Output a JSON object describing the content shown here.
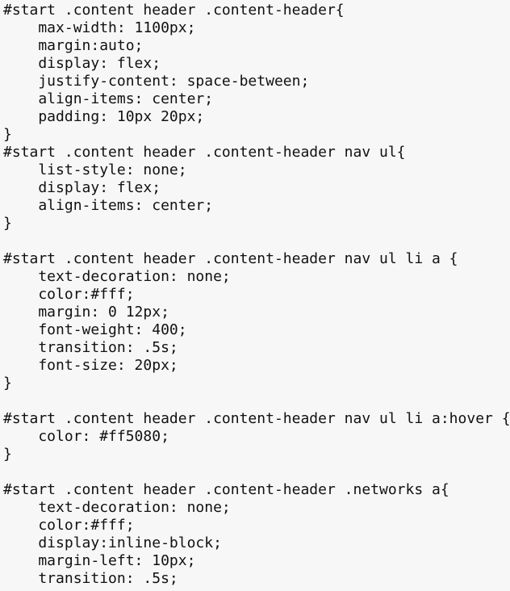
{
  "document": {
    "kind": "css-source-listing",
    "language": "CSS",
    "background_color": "#f7f7f7",
    "text_color": "#111111",
    "indent": "    ",
    "lines": [
      "#start .content header .content-header{",
      "    max-width: 1100px;",
      "    margin:auto;",
      "    display: flex;",
      "    justify-content: space-between;",
      "    align-items: center;",
      "    padding: 10px 20px;",
      "}",
      "#start .content header .content-header nav ul{",
      "    list-style: none;",
      "    display: flex;",
      "    align-items: center;",
      "}",
      "",
      "#start .content header .content-header nav ul li a {",
      "    text-decoration: none;",
      "    color:#fff;",
      "    margin: 0 12px;",
      "    font-weight: 400;",
      "    transition: .5s;",
      "    font-size: 20px;",
      "}",
      "",
      "#start .content header .content-header nav ul li a:hover {",
      "    color: #ff5080;",
      "}",
      "",
      "#start .content header .content-header .networks a{",
      "    text-decoration: none;",
      "    color:#fff;",
      "    display:inline-block;",
      "    margin-left: 10px;",
      "    transition: .5s;"
    ],
    "rules": [
      {
        "selector": "#start .content header .content-header",
        "declarations": [
          {
            "property": "max-width",
            "value": "1100px"
          },
          {
            "property": "margin",
            "value": "auto"
          },
          {
            "property": "display",
            "value": "flex"
          },
          {
            "property": "justify-content",
            "value": "space-between"
          },
          {
            "property": "align-items",
            "value": "center"
          },
          {
            "property": "padding",
            "value": "10px 20px"
          }
        ]
      },
      {
        "selector": "#start .content header .content-header nav ul",
        "declarations": [
          {
            "property": "list-style",
            "value": "none"
          },
          {
            "property": "display",
            "value": "flex"
          },
          {
            "property": "align-items",
            "value": "center"
          }
        ]
      },
      {
        "selector": "#start .content header .content-header nav ul li a",
        "declarations": [
          {
            "property": "text-decoration",
            "value": "none"
          },
          {
            "property": "color",
            "value": "#fff"
          },
          {
            "property": "margin",
            "value": "0 12px"
          },
          {
            "property": "font-weight",
            "value": "400"
          },
          {
            "property": "transition",
            "value": ".5s"
          },
          {
            "property": "font-size",
            "value": "20px"
          }
        ]
      },
      {
        "selector": "#start .content header .content-header nav ul li a:hover",
        "declarations": [
          {
            "property": "color",
            "value": "#ff5080"
          }
        ]
      },
      {
        "selector": "#start .content header .content-header .networks a",
        "declarations": [
          {
            "property": "text-decoration",
            "value": "none"
          },
          {
            "property": "color",
            "value": "#fff"
          },
          {
            "property": "display",
            "value": "inline-block"
          },
          {
            "property": "margin-left",
            "value": "10px"
          },
          {
            "property": "transition",
            "value": ".5s"
          }
        ]
      }
    ],
    "colors_referenced": [
      "#fff",
      "#ff5080"
    ]
  }
}
